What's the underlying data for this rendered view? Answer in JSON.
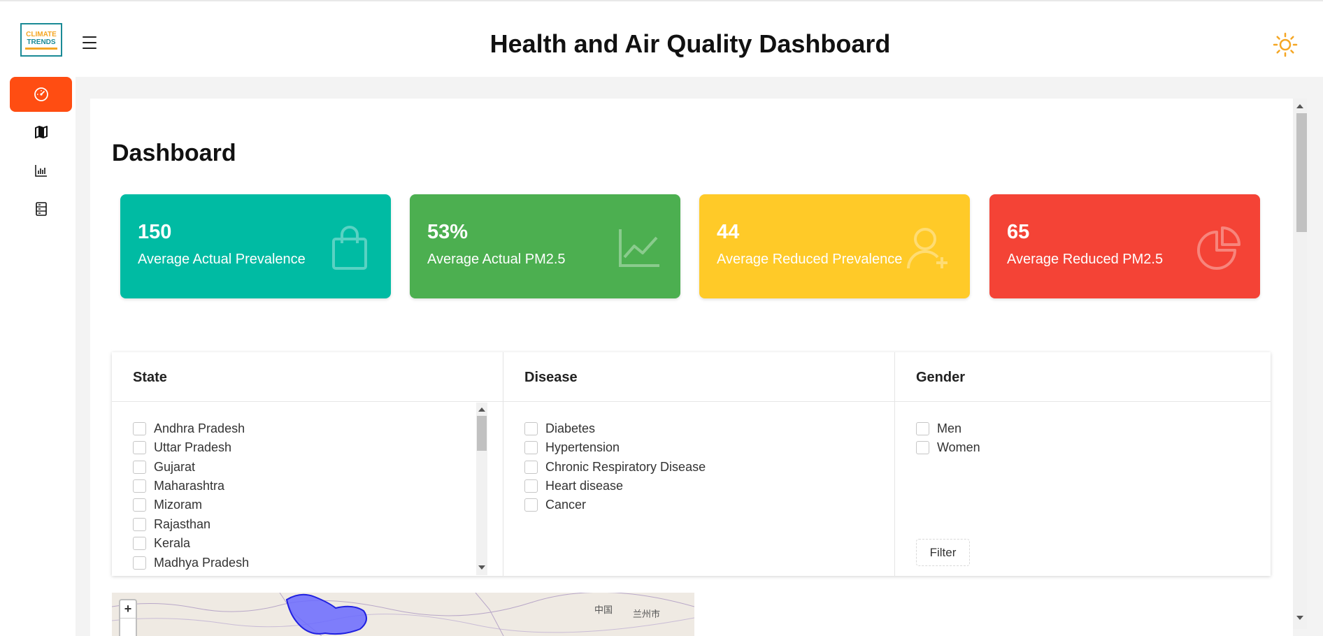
{
  "header": {
    "title": "Health and Air Quality Dashboard",
    "logo_line1": "CLIMATE",
    "logo_line2": "TRENDS"
  },
  "sidebar": {
    "items": [
      {
        "icon": "speedometer-icon",
        "active": true
      },
      {
        "icon": "map-icon",
        "active": false
      },
      {
        "icon": "bar-chart-icon",
        "active": false
      },
      {
        "icon": "table-icon",
        "active": false
      }
    ]
  },
  "main": {
    "heading": "Dashboard",
    "cards": [
      {
        "value": "150",
        "label": "Average Actual Prevalence",
        "color": "#00bba3",
        "icon": "shopping-bag-icon"
      },
      {
        "value": "53%",
        "label": "Average Actual PM2.5",
        "color": "#4caf50",
        "icon": "line-chart-icon"
      },
      {
        "value": "44",
        "label": "Average Reduced Prevalence",
        "color": "#ffca28",
        "icon": "user-add-icon"
      },
      {
        "value": "65",
        "label": "Average Reduced PM2.5",
        "color": "#f44336",
        "icon": "pie-chart-icon"
      }
    ],
    "filters": {
      "state": {
        "title": "State",
        "options": [
          "Andhra Pradesh",
          "Uttar Pradesh",
          "Gujarat",
          "Maharashtra",
          "Mizoram",
          "Rajasthan",
          "Kerala",
          "Madhya Pradesh"
        ]
      },
      "disease": {
        "title": "Disease",
        "options": [
          "Diabetes",
          "Hypertension",
          "Chronic Respiratory Disease",
          "Heart disease",
          "Cancer"
        ]
      },
      "gender": {
        "title": "Gender",
        "options": [
          "Men",
          "Women"
        ],
        "button": "Filter"
      }
    },
    "map": {
      "zoom_in": "+",
      "label_china": "中国",
      "label_lanzhou": "兰州市"
    }
  },
  "colors": {
    "accent": "#ff4d12",
    "sun": "#f5a623"
  }
}
